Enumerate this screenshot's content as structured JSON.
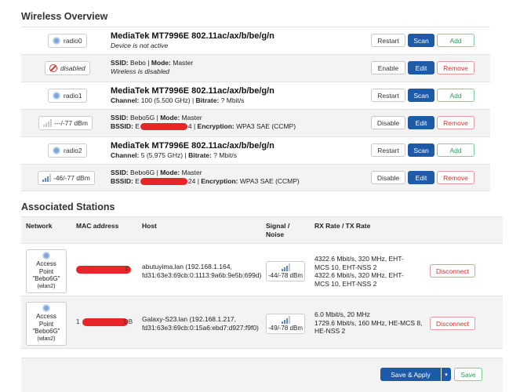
{
  "wireless_overview": {
    "title": "Wireless Overview",
    "rows": [
      {
        "badge": "radio0",
        "title": "MediaTek MT7996E 802.11ac/ax/b/be/g/n",
        "line2": "Device is not active",
        "buttons": [
          "Restart",
          "Scan",
          "Add"
        ]
      },
      {
        "badge": "disabled",
        "ssid_label": "SSID:",
        "ssid": "Bebo",
        "mode_label": "Mode:",
        "mode": "Master",
        "line2": "Wireless is disabled",
        "buttons": [
          "Enable",
          "Edit",
          "Remove"
        ]
      },
      {
        "badge": "radio1",
        "title": "MediaTek MT7996E 802.11ac/ax/b/be/g/n",
        "channel_label": "Channel:",
        "channel": "100 (5.500 GHz)",
        "bitrate_label": "Bitrate:",
        "bitrate": "? Mbit/s",
        "buttons": [
          "Restart",
          "Scan",
          "Add"
        ]
      },
      {
        "badge": "---/-77 dBm",
        "ssid_label": "SSID:",
        "ssid": "Bebo5G",
        "mode_label": "Mode:",
        "mode": "Master",
        "bssid_label": "BSSID:",
        "bssid_start": "E",
        "bssid_end": "4",
        "enc_label": "Encryption:",
        "encryption": "WPA3 SAE (CCMP)",
        "buttons": [
          "Disable",
          "Edit",
          "Remove"
        ]
      },
      {
        "badge": "radio2",
        "title": "MediaTek MT7996E 802.11ac/ax/b/be/g/n",
        "channel_label": "Channel:",
        "channel": "5 (5.975 GHz)",
        "bitrate_label": "Bitrate:",
        "bitrate": "? Mbit/s",
        "buttons": [
          "Restart",
          "Scan",
          "Add"
        ]
      },
      {
        "badge": "-46/-77 dBm",
        "ssid_label": "SSID:",
        "ssid": "Bebo6G",
        "mode_label": "Mode:",
        "mode": "Master",
        "bssid_label": "BSSID:",
        "bssid_start": "E",
        "bssid_end": "24",
        "enc_label": "Encryption:",
        "encryption": "WPA3 SAE (CCMP)",
        "buttons": [
          "Disable",
          "Edit",
          "Remove"
        ]
      }
    ]
  },
  "associated_stations": {
    "title": "Associated Stations",
    "headers": {
      "network": "Network",
      "mac": "MAC address",
      "host": "Host",
      "signal": "Signal /",
      "noise": "Noise",
      "rate": "RX Rate / TX Rate"
    },
    "rows": [
      {
        "ap": [
          "Access",
          "Point",
          "\"Bebo6G\"",
          "(wlan2)"
        ],
        "mac_tail": "F",
        "host": [
          "abutuyima.lan (192.168.1.164,",
          "fd31:63e3:69cb:0:1113:9a6b:9e5b:699d)"
        ],
        "signal": "-44/-78 dBm",
        "rate": [
          "4322.6 Mbit/s, 320 MHz, EHT-",
          "MCS 10, EHT-NSS 2",
          "4322.6 Mbit/s, 320 MHz, EHT-",
          "MCS 10, EHT-NSS 2"
        ],
        "action": "Disconnect"
      },
      {
        "ap": [
          "Access",
          "Point",
          "\"Bebo6G\"",
          "(wlan2)"
        ],
        "mac_head": "1",
        "mac_tail": "DB",
        "host": [
          "Galaxy-S23.lan (192.168.1.217,",
          "fd31:63e3:69cb:0:15a6:ebd7:d927:f9f0)"
        ],
        "signal": "-49/-78 dBm",
        "rate": [
          "6.0 Mbit/s, 20 MHz",
          "1729.6 Mbit/s, 160 MHz, HE-MCS 8,",
          "HE-NSS 2"
        ],
        "action": "Disconnect"
      }
    ]
  },
  "footer": {
    "save_apply": "Save & Apply",
    "dropdown": "▾",
    "save": "Save"
  }
}
